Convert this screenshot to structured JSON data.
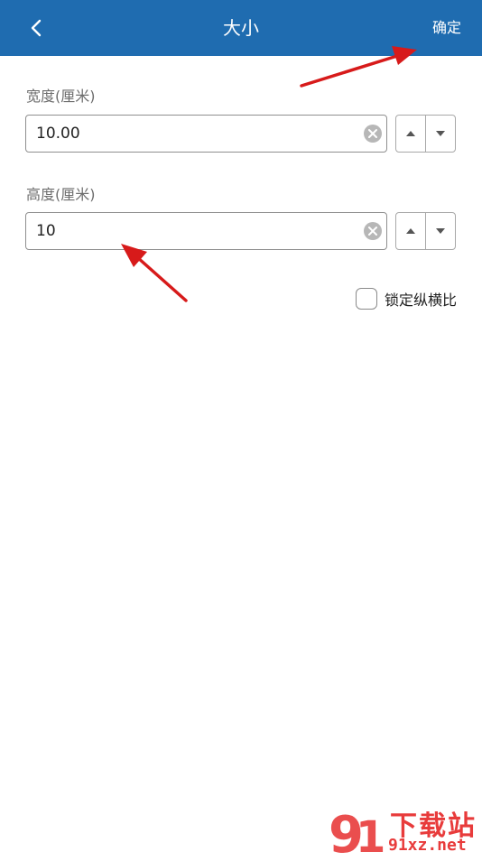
{
  "header": {
    "title": "大小",
    "confirm_label": "确定"
  },
  "width_field": {
    "label": "宽度(厘米)",
    "value": "10.00"
  },
  "height_field": {
    "label": "高度(厘米)",
    "value": "10"
  },
  "lock_aspect": {
    "label": "锁定纵横比",
    "checked": false
  },
  "watermark": {
    "brand": "下载站",
    "domain": "91xz.net"
  },
  "colors": {
    "header_bg": "#1f6cb0",
    "annotation_arrow": "#d71a1a"
  }
}
